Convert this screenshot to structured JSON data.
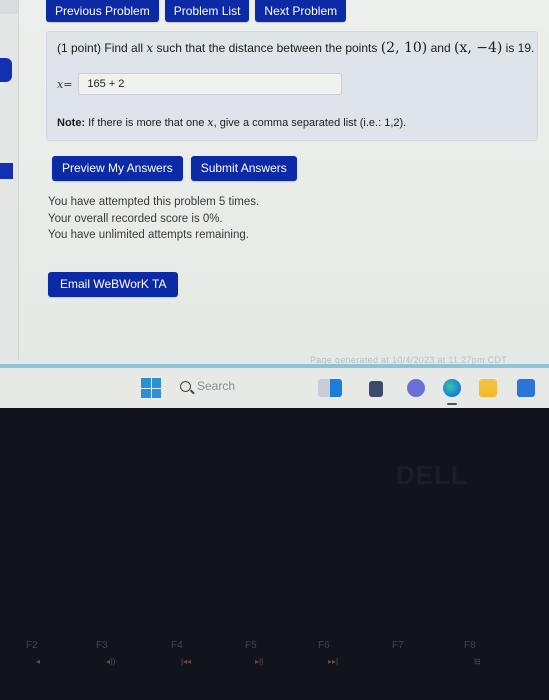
{
  "nav": {
    "previous": "Previous Problem",
    "list": "Problem List",
    "next": "Next Problem"
  },
  "problem": {
    "points_label": "(1 point)",
    "statement_pre": "Find all",
    "var": "x",
    "statement_mid": "such that the distance between the points",
    "point1": "(2, 10)",
    "and": "and",
    "point2": "(x, −4)",
    "statement_post": "is 19.",
    "answer_label": "x=",
    "answer_value": "165 + 2",
    "note_bold": "Note:",
    "note_pre": "If there is more that one",
    "note_var": "x",
    "note_post": ", give a comma separated list (i.e.: 1,2)."
  },
  "actions": {
    "preview": "Preview My Answers",
    "submit": "Submit Answers"
  },
  "status": {
    "attempts": "You have attempted this problem 5 times.",
    "score": "Your overall recorded score is 0%.",
    "remaining": "You have unlimited attempts remaining."
  },
  "email_button": "Email WeBWorK TA",
  "footer_text": "Page generated at 10/4/2023 at 11:27pm CDT",
  "taskbar": {
    "search_placeholder": "Search",
    "icons": [
      "windows-start-icon",
      "search-icon",
      "widgets-icon",
      "task-view-icon",
      "teams-chat-icon",
      "edge-browser-icon",
      "file-explorer-icon",
      "microsoft-store-icon"
    ]
  },
  "keyboard": {
    "brand": "DELL",
    "fkeys": [
      {
        "label": "F2",
        "sub": "◂"
      },
      {
        "label": "F3",
        "sub": "◂))"
      },
      {
        "label": "F4",
        "sub": "|◂◂"
      },
      {
        "label": "F5",
        "sub": "▸||"
      },
      {
        "label": "F6",
        "sub": "▸▸|"
      },
      {
        "label": "F7",
        "sub": ""
      },
      {
        "label": "F8",
        "sub": "⊟"
      }
    ]
  }
}
